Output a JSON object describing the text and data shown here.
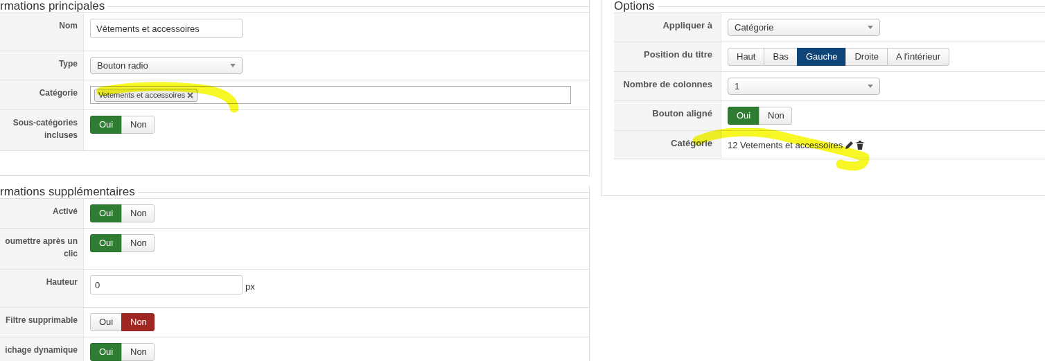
{
  "left_sections": [
    {
      "title": "rmations principales",
      "rows": [
        {
          "label": "Nom",
          "kind": "text",
          "value": "Vêtements et accessoires"
        },
        {
          "label": "Type",
          "kind": "select",
          "value": "Bouton radio"
        },
        {
          "label": "Catégorie",
          "kind": "tags",
          "tags": [
            "Vetements et accessoires"
          ],
          "highlighted": true
        },
        {
          "label": "Sous-catégories incluses",
          "kind": "toggle",
          "options": [
            {
              "label": "Oui",
              "selected": true
            },
            {
              "label": "Non",
              "selected": false
            }
          ]
        }
      ]
    },
    {
      "title": "rmations supplémentaires",
      "rows": [
        {
          "label": "Activé",
          "kind": "toggle",
          "options": [
            {
              "label": "Oui",
              "selected": true
            },
            {
              "label": "Non",
              "selected": false
            }
          ]
        },
        {
          "label": "oumettre après un clic",
          "kind": "toggle",
          "options": [
            {
              "label": "Oui",
              "selected": true
            },
            {
              "label": "Non",
              "selected": false
            }
          ]
        },
        {
          "label": "Hauteur",
          "kind": "unit",
          "value": "0",
          "unit": "px"
        },
        {
          "label": "Filtre supprimable",
          "kind": "toggle",
          "options": [
            {
              "label": "Oui",
              "selected": false
            },
            {
              "label": "Non",
              "selected": true
            }
          ]
        },
        {
          "label": "ichage dynamique",
          "kind": "toggle",
          "options": [
            {
              "label": "Oui",
              "selected": true
            },
            {
              "label": "Non",
              "selected": false
            }
          ]
        }
      ]
    }
  ],
  "right_sections": [
    {
      "title": "Options",
      "rows": [
        {
          "label": "Appliquer à",
          "kind": "select",
          "value": "Catégorie"
        },
        {
          "label": "Position du titre",
          "kind": "segmented",
          "options": [
            {
              "label": "Haut",
              "selected": false
            },
            {
              "label": "Bas",
              "selected": false
            },
            {
              "label": "Gauche",
              "selected": true
            },
            {
              "label": "Droite",
              "selected": false
            },
            {
              "label": "A l'intérieur",
              "selected": false
            }
          ]
        },
        {
          "label": "Nombre de colonnes",
          "kind": "select",
          "value": "1"
        },
        {
          "label": "Bouton aligné",
          "kind": "toggle",
          "options": [
            {
              "label": "Oui",
              "selected": true
            },
            {
              "label": "Non",
              "selected": false
            }
          ]
        },
        {
          "label": "Catégorie",
          "kind": "display",
          "value": "12 Vetements et accessoires",
          "highlighted": true
        }
      ]
    }
  ]
}
